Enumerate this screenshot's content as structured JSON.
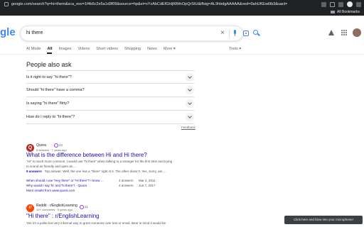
{
  "browser": {
    "url": "google.com/search?q=hi+there&sca_esv=1f4b6c2e5a1d3f09&source=hp&ei=xYzAbCdEfGhIjKlMnOpQrStU&iflsig=AL9hbdgAAAAA&ved=0ahUKEwi9b3&uact=5&oq=hi+there&gs_lp=Egdnd3Mtd2l6Ighoa",
    "bookmarks_label": "All Bookmarks"
  },
  "logo_text": "gle",
  "search": {
    "query": "hi there"
  },
  "tabs": [
    {
      "label": "AI Mode"
    },
    {
      "label": "All"
    },
    {
      "label": "Images"
    },
    {
      "label": "Videos"
    },
    {
      "label": "Short videos"
    },
    {
      "label": "Shopping"
    },
    {
      "label": "News"
    },
    {
      "label": "More ▾"
    }
  ],
  "tools_label": "Tools ▾",
  "paa": {
    "title": "People also ask",
    "questions": [
      "Is it right to say \"hi there\"?",
      "Should \"hi there\" have a comma?",
      "Is saying \"hi there\" flirty?",
      "How do I reply to \"hi there\"?"
    ],
    "feedback": "Feedback"
  },
  "result1": {
    "favicon_letter": "Q",
    "site": "Quora",
    "meta": "6 answers · 7 years ago",
    "comment_count": "24",
    "title": "What is the difference between Hi and Hi there?",
    "snippet_line1": "\"Hi\" is much more common. I would use \"hi there\" when talking to a stranger for the first time and trying",
    "snippet_line2": "to sound as friendly and open as ...",
    "answers_count": "9 answers",
    "answers_rest": " · Top answer: Well, the one has a \"there\" right in it. The other doesn't. Yes, Sorry, am ...",
    "sub_results": [
      {
        "q": "When should I use \"Hey there\" or \"Hi there\"? I know ...",
        "answers": "4 answers",
        "date": "Mar 4, 2011"
      },
      {
        "q": "Why would I say 'hi' and 'hi there'? · Quora",
        "answers": "4 answers",
        "date": "Jun 7, 2017"
      }
    ],
    "more": "More results from www.quora.com"
  },
  "result2": {
    "favicon_letter": "r/",
    "site": "Reddit · r/EnglishLearning",
    "meta": "10+ comments · 5 years ago",
    "comment_count": "21",
    "title": "\"Hi there\" : r/EnglishLearning",
    "snippet": "Yes it's a polite but very informal way to greet someone over text or email. Bear in mind it would be"
  },
  "toast": "Click here and blow into your microphone!",
  "colors": {
    "link": "#1a0dab",
    "chrome_bg": "#202124",
    "google_blue": "#4285f4"
  }
}
